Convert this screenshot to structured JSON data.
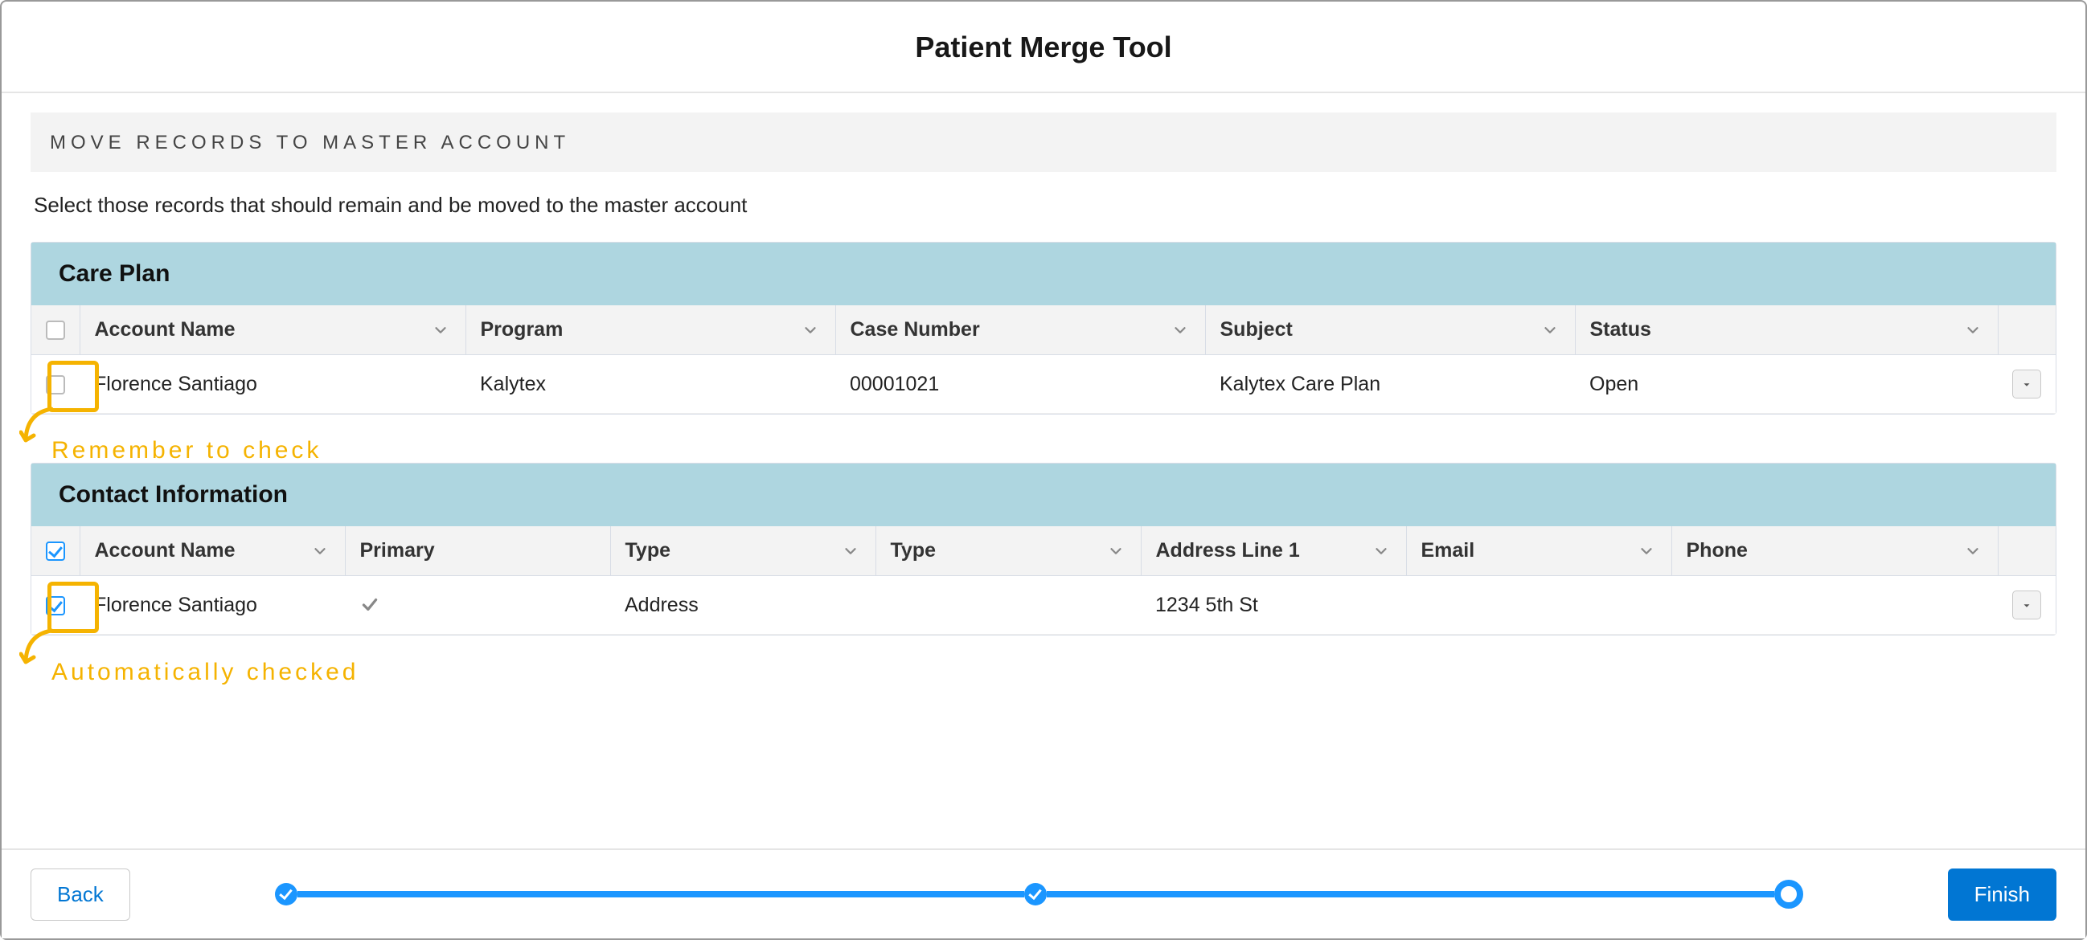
{
  "page_title": "Patient Merge Tool",
  "section_header": "MOVE RECORDS TO MASTER ACCOUNT",
  "instruction": "Select those records that should remain and be moved to the master account",
  "annotations": {
    "remember": "Remember to check",
    "auto": "Automatically checked"
  },
  "tables": {
    "care_plan": {
      "title": "Care Plan",
      "select_all_checked": false,
      "columns": [
        "Account Name",
        "Program",
        "Case Number",
        "Subject",
        "Status"
      ],
      "rows": [
        {
          "checked": false,
          "account_name": "Florence Santiago",
          "program": "Kalytex",
          "case_number": "00001021",
          "subject": "Kalytex Care Plan",
          "status": "Open"
        }
      ]
    },
    "contact_info": {
      "title": "Contact Information",
      "select_all_checked": true,
      "columns": [
        "Account Name",
        "Primary",
        "Type",
        "Type",
        "Address Line 1",
        "Email",
        "Phone"
      ],
      "rows": [
        {
          "checked": true,
          "account_name": "Florence Santiago",
          "primary": true,
          "type1": "Address",
          "type2": "",
          "address_line_1": "1234 5th St",
          "email": "",
          "phone": ""
        }
      ]
    }
  },
  "footer": {
    "back": "Back",
    "finish": "Finish",
    "steps_total": 3,
    "steps_done": 2,
    "current_step": 3
  }
}
